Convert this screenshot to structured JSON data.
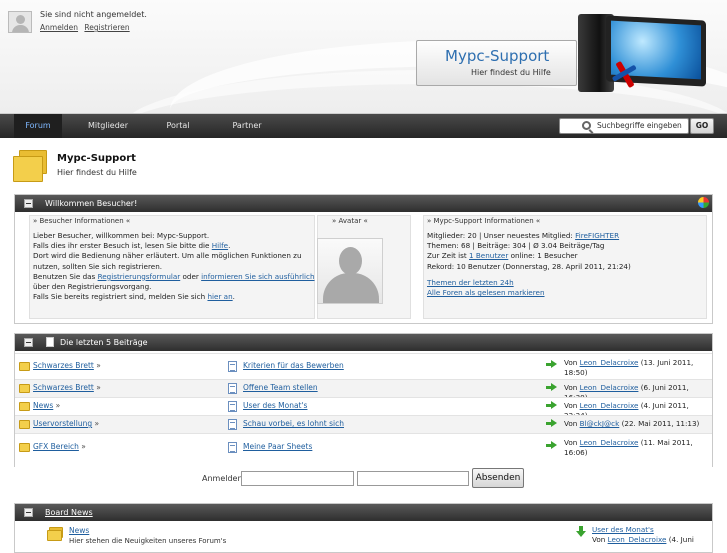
{
  "user": {
    "status": "Sie sind nicht angemeldet.",
    "login_link": "Anmelden",
    "register_link": "Registrieren"
  },
  "logo": {
    "title": "Mypc-Support",
    "subtitle": "Hier findest du Hilfe"
  },
  "nav": {
    "items": [
      "Forum",
      "Mitglieder",
      "Portal",
      "Partner"
    ],
    "active": "Forum"
  },
  "search": {
    "placeholder": "Suchbegriffe eingeben",
    "button": "GO"
  },
  "board": {
    "title": "Mypc-Support",
    "subtitle": "Hier findest du Hilfe"
  },
  "welcome": {
    "header": "Willkommen Besucher!",
    "visitor_title": "» Besucher Informationen «",
    "visitor_text": {
      "l1": "Lieber Besucher, willkommen bei: Mypc-Support.",
      "l2_pre": "Falls dies ihr erster Besuch ist, lesen Sie bitte die ",
      "l2_link": "Hilfe",
      "l2_post": ".",
      "l3": "Dort wird die Bedienung näher erläutert. Um alle möglichen Funktionen zu",
      "l4": "nutzen, sollten Sie sich registrieren.",
      "l5_pre": "Benutzen Sie das ",
      "l5_link1": "Registrierungsformular",
      "l5_mid": " oder ",
      "l5_link2": "informieren Sie sich ausführlich",
      "l6": "über den Registrierungsvorgang.",
      "l7_pre": "Falls Sie bereits registriert sind, melden Sie sich ",
      "l7_link": "hier an",
      "l7_post": "."
    },
    "avatar_title": "» Avatar «",
    "info_title": "» Mypc-Support Informationen «",
    "info": {
      "l1_pre": "Mitglieder: 20 | Unser neuestes Mitglied: ",
      "l1_link": "FireFIGHTER",
      "l2": "Themen: 68 | Beiträge: 304 | Ø 3.04 Beiträge/Tag",
      "l3_pre": "Zur Zeit ist ",
      "l3_link": "1 Benutzer",
      "l3_post": " online: 1 Besucher",
      "l4": "Rekord: 10 Benutzer (Donnerstag, 28. April 2011, 21:24)",
      "link1": "Themen der letzten 24h",
      "link2": "Alle Foren als gelesen markieren"
    }
  },
  "latest": {
    "header": "Die letzten 5 Beiträge",
    "by": "Von",
    "rows": [
      {
        "forum": "Schwarzes Brett",
        "thread": "Kriterien für das Bewerben",
        "user": "Leon_Delacroixe",
        "date1": "(13. Juni 2011,",
        "date2": "18:50)"
      },
      {
        "forum": "Schwarzes Brett",
        "thread": "Offene Team stellen",
        "user": "Leon_Delacroixe",
        "date1": "(6. Juni 2011, 16:30)",
        "date2": ""
      },
      {
        "forum": "News",
        "thread": "User des Monat's",
        "user": "Leon_Delacroixe",
        "date1": "(4. Juni 2011, 22:24)",
        "date2": ""
      },
      {
        "forum": "Uservorstellung",
        "thread": "Schau vorbei, es lohnt sich",
        "user": "Bl@ckJ@ck",
        "date1": "(22. Mai 2011, 11:13)",
        "date2": ""
      },
      {
        "forum": "GFX Bereich",
        "thread": "Meine Paar Sheets",
        "user": "Leon_Delacroixe",
        "date1": "(11. Mai 2011,",
        "date2": "16:06)"
      }
    ]
  },
  "login_form": {
    "label": "Anmelden:",
    "submit": "Absenden"
  },
  "news": {
    "header": "Board News",
    "forum": "News",
    "desc": "Hier stehen die Neuigkeiten unseres Forum's",
    "last_thread": "User des Monat's",
    "by": "Von",
    "user": "Leon_Delacroixe",
    "date": "(4. Juni"
  }
}
